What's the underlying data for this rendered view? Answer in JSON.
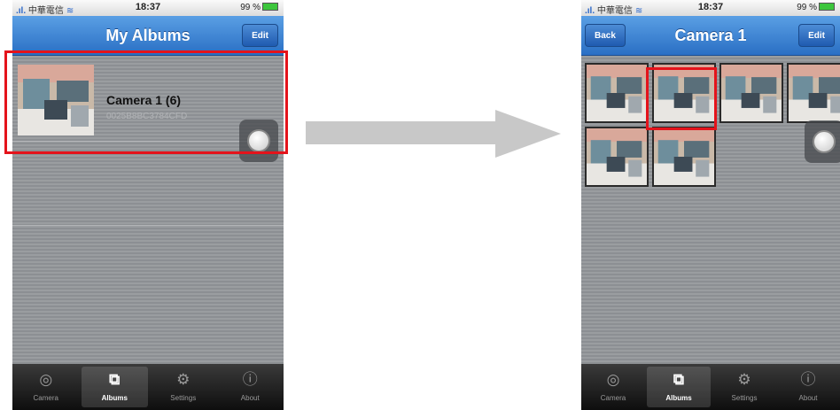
{
  "status_bar": {
    "carrier": "中華電信",
    "time": "18:37",
    "battery": "99 %"
  },
  "left_screen": {
    "title": "My Albums",
    "edit_label": "Edit",
    "album": {
      "name": "Camera 1 (6)",
      "id": "0025B8BC3784CFD"
    }
  },
  "right_screen": {
    "title": "Camera 1",
    "back_label": "Back",
    "edit_label": "Edit",
    "photo_count": 6
  },
  "tabs": [
    {
      "label": "Camera",
      "icon": "camera-icon"
    },
    {
      "label": "Albums",
      "icon": "albums-icon",
      "active": true
    },
    {
      "label": "Settings",
      "icon": "settings-icon"
    },
    {
      "label": "About",
      "icon": "info-icon"
    }
  ],
  "colors": {
    "navbar": "#2a6fc4",
    "highlight": "#e4131b",
    "arrow": "#c8c8c8"
  }
}
